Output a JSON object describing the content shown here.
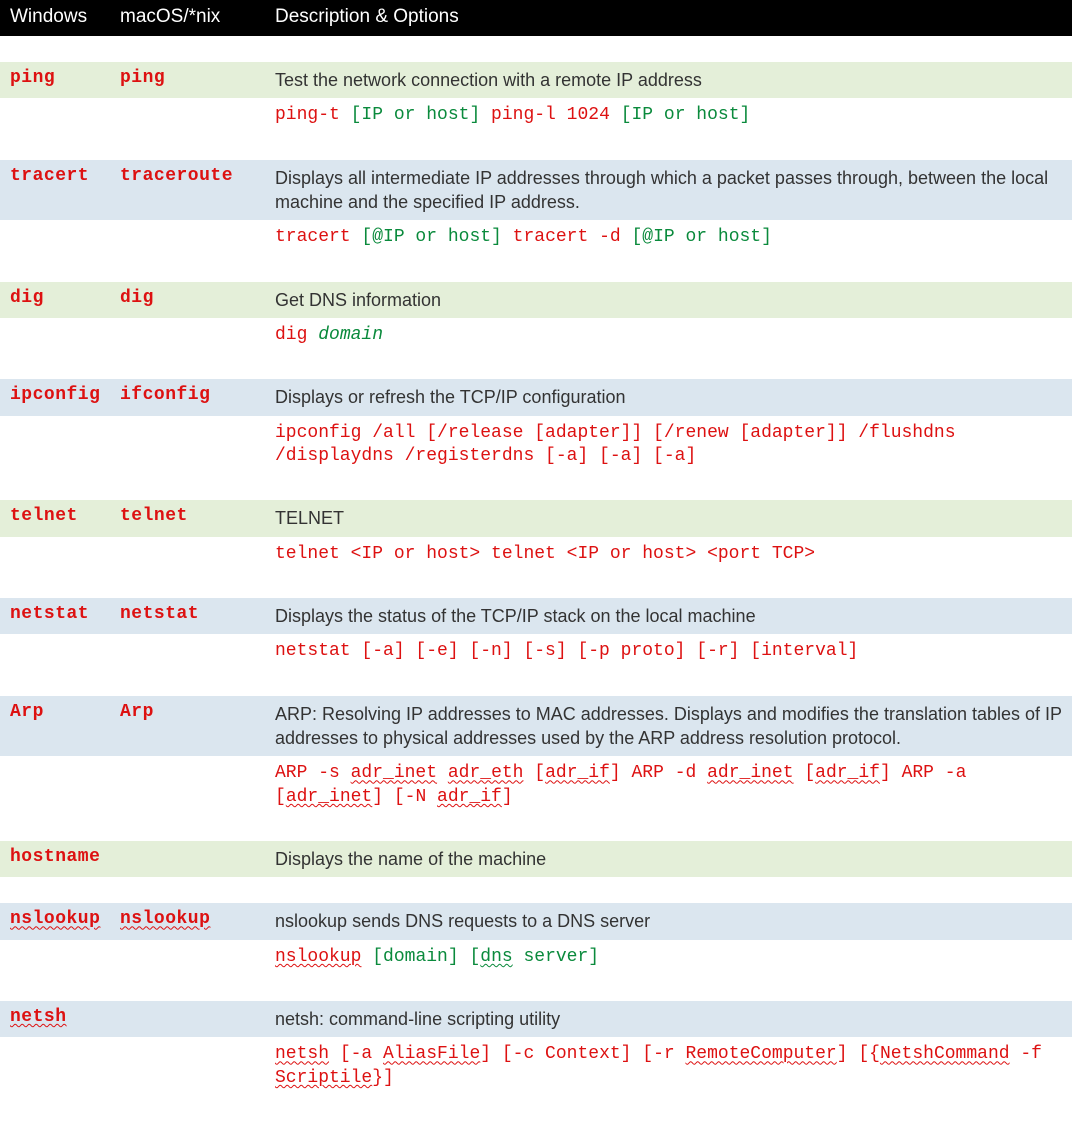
{
  "headers": {
    "windows": "Windows",
    "macos": "macOS/*nix",
    "desc": "Description & Options"
  },
  "rows": [
    {
      "win": "ping",
      "mac": "ping",
      "desc": "Test the network connection with a remote IP address",
      "opt_html": "<span class='c-red'>ping-t </span><span class='c-green'>[IP or host]</span><span class='c-red'> ping-l 1024 </span><span class='c-green'>[IP or host]</span>",
      "colorClass": "row-green"
    },
    {
      "win": "tracert",
      "mac": "traceroute",
      "desc": "Displays all intermediate IP addresses through which a packet passes through, between the local machine and the specified IP address.",
      "opt_html": "<span class='c-red'>tracert </span><span class='c-green'>[@IP or host]</span><span class='c-red'> tracert -d </span><span class='c-green'>[@IP or host]</span>",
      "colorClass": "row-blue"
    },
    {
      "win": "dig",
      "mac": "dig",
      "desc": "Get DNS information",
      "opt_html": "<span class='c-red'>dig </span><span class='c-green-ital'>domain</span>",
      "colorClass": "row-green"
    },
    {
      "win": "ipconfig",
      "mac": "ifconfig",
      "desc": "Displays or refresh the TCP/IP configuration",
      "opt_html": "<span class='c-red'>ipconfig /all [/release [adapter]] [/renew [adapter]] /flushdns /displaydns /registerdns [-a] [-a] [-a]</span>",
      "colorClass": "row-blue"
    },
    {
      "win": "telnet",
      "mac": "telnet",
      "desc": "TELNET",
      "opt_html": "<span class='c-red'>telnet &lt;IP or host&gt; telnet &lt;IP or host&gt; &lt;port TCP&gt;</span>",
      "colorClass": "row-green"
    },
    {
      "win": "netstat",
      "mac": "netstat",
      "desc": "Displays the status of the TCP/IP stack on the local machine",
      "opt_html": "<span class='c-red'>netstat [-a] [-e] [-n] [-s] [-p proto] [-r] [interval]</span>",
      "colorClass": "row-blue"
    },
    {
      "win": "Arp",
      "mac": "Arp",
      "desc": "ARP: Resolving IP addresses to MAC addresses. Displays and modifies the translation tables of IP addresses to physical addresses used by the ARP address resolution protocol.",
      "opt_html": "<span class='c-red'>ARP -s <span class='squiggle'>adr_inet</span> <span class='squiggle'>adr_eth</span> [<span class='squiggle'>adr_if</span>] ARP -d <span class='squiggle'>adr_inet</span> [<span class='squiggle'>adr_if</span>] ARP -a [<span class='squiggle'>adr_inet</span>] [-N <span class='squiggle'>adr_if</span>]</span>",
      "colorClass": "row-blue"
    },
    {
      "win": "hostname",
      "mac": "",
      "desc": "Displays the name of the machine",
      "opt_html": "",
      "colorClass": "row-green"
    },
    {
      "win_html": "<span class='squiggle'>nslookup</span>",
      "mac_html": "<span class='squiggle'>nslookup</span>",
      "desc_html": "<span class='squiggle' style='text-decoration:none'>nslookup</span> sends DNS requests to a DNS server",
      "opt_html": "<span class='c-red'><span class='squiggle'>nslookup</span> </span><span class='c-green'>[domain] </span><span class='c-green'>[<span class='squiggle' style='text-decoration-color:#0a8a3c'>dns</span> server]</span>",
      "colorClass": "row-blue"
    },
    {
      "win_html": "<span class='squiggle'>netsh</span>",
      "mac": "",
      "desc_html": "netsh: command-line scripting utility",
      "opt_html": "<span class='c-red'><span class='squiggle'>netsh</span> [-a <span class='squiggle'>AliasFile</span>] [-c Context] [-r <span class='squiggle'>RemoteComputer</span>] [{<span class='squiggle'>NetshCommand</span> -f <span class='squiggle'>Scriptile</span>}]</span>",
      "colorClass": "row-blue"
    }
  ]
}
